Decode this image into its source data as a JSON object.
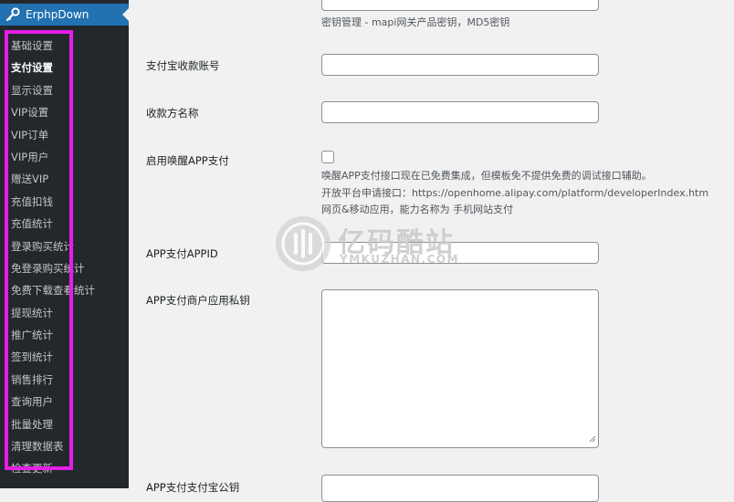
{
  "sidebar": {
    "plugin_title": "ErphpDown",
    "items": [
      {
        "label": "基础设置"
      },
      {
        "label": "支付设置"
      },
      {
        "label": "显示设置"
      },
      {
        "label": "VIP设置"
      },
      {
        "label": "VIP订单"
      },
      {
        "label": "VIP用户"
      },
      {
        "label": "赠送VIP"
      },
      {
        "label": "充值扣钱"
      },
      {
        "label": "充值统计"
      },
      {
        "label": "登录购买统计"
      },
      {
        "label": "免登录购买统计"
      },
      {
        "label": "免费下载查看统计"
      },
      {
        "label": "提现统计"
      },
      {
        "label": "推广统计"
      },
      {
        "label": "签到统计"
      },
      {
        "label": "销售排行"
      },
      {
        "label": "查询用户"
      },
      {
        "label": "批量处理"
      },
      {
        "label": "清理数据表"
      },
      {
        "label": "检查更新"
      }
    ],
    "highlight_color": "#e61ee6"
  },
  "form": {
    "top_desc": "密钥管理 - mapi网关产品密钥，MD5密钥",
    "alipay_account_label": "支付宝收款账号",
    "alipay_account_value": "",
    "payee_name_label": "收款方名称",
    "payee_name_value": "",
    "app_pay_label": "启用唤醒APP支付",
    "app_pay_checked": false,
    "app_pay_desc1": "唤醒APP支付接口现在已免费集成，但模板免不提供免费的调试接口辅助。",
    "app_pay_desc2": "开放平台申请接口：https://openhome.alipay.com/platform/developerIndex.htm",
    "app_pay_desc3": "网页&移动应用，能力名称为 手机网站支付",
    "appid_label": "APP支付APPID",
    "appid_value": "",
    "private_key_label": "APP支付商户应用私钥",
    "private_key_value": "",
    "public_key_label": "APP支付支付宝公钥"
  },
  "watermark": {
    "text": "亿码酷站",
    "sub": "YMKUZHAN.COM"
  }
}
